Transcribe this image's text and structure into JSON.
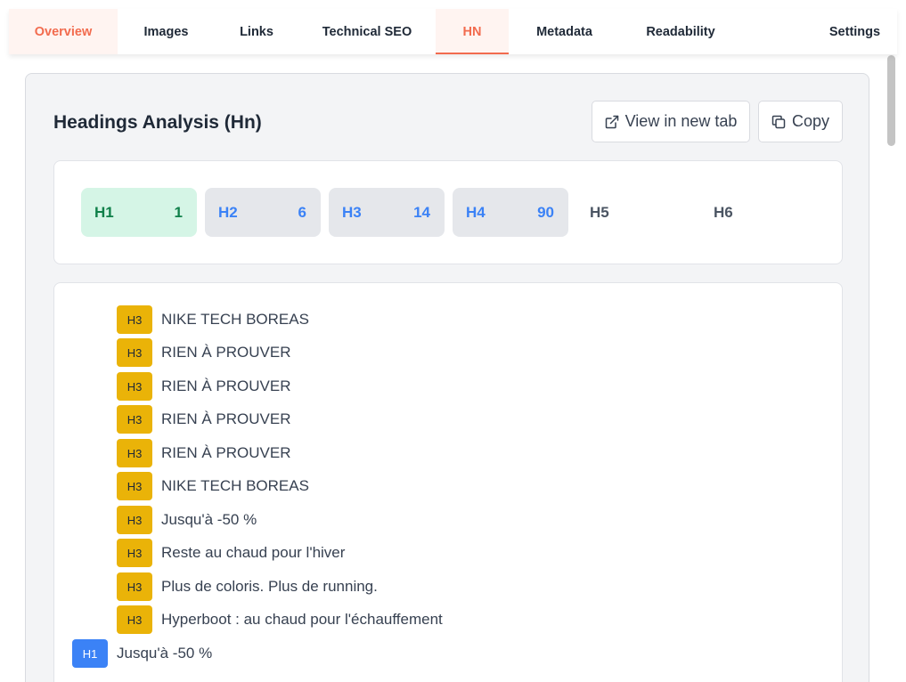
{
  "tabs": [
    {
      "label": "Overview"
    },
    {
      "label": "Images"
    },
    {
      "label": "Links"
    },
    {
      "label": "Technical SEO"
    },
    {
      "label": "HN"
    },
    {
      "label": "Metadata"
    },
    {
      "label": "Readability"
    },
    {
      "label": "Settings"
    }
  ],
  "panel": {
    "title": "Headings Analysis (Hn)",
    "view_button": "View in new tab",
    "copy_button": "Copy"
  },
  "counts": [
    {
      "level": "H1",
      "count": "1"
    },
    {
      "level": "H2",
      "count": "6"
    },
    {
      "level": "H3",
      "count": "14"
    },
    {
      "level": "H4",
      "count": "90"
    },
    {
      "level": "H5",
      "count": ""
    },
    {
      "level": "H6",
      "count": ""
    }
  ],
  "headings": [
    {
      "tag": "H3",
      "text": "NIKE TECH BOREAS"
    },
    {
      "tag": "H3",
      "text": "RIEN À PROUVER"
    },
    {
      "tag": "H3",
      "text": "RIEN À PROUVER"
    },
    {
      "tag": "H3",
      "text": "RIEN À PROUVER"
    },
    {
      "tag": "H3",
      "text": "RIEN À PROUVER"
    },
    {
      "tag": "H3",
      "text": "NIKE TECH BOREAS"
    },
    {
      "tag": "H3",
      "text": "Jusqu'à -50 %"
    },
    {
      "tag": "H3",
      "text": "Reste au chaud pour l'hiver"
    },
    {
      "tag": "H3",
      "text": "Plus de coloris. Plus de running."
    },
    {
      "tag": "H3",
      "text": "Hyperboot : au chaud pour l'échauffement"
    },
    {
      "tag": "H1",
      "text": "Jusqu'à -50 %"
    }
  ],
  "colors": {
    "accent": "#f26b4e",
    "h1_pill_bg": "#d5f5e6",
    "h1_pill_text": "#10804a",
    "count_blue": "#3b82f6",
    "h3_badge": "#eab308",
    "h1_badge": "#3b82f6"
  },
  "icons": {
    "view_button": "external-link-icon",
    "copy_button": "copy-icon"
  }
}
